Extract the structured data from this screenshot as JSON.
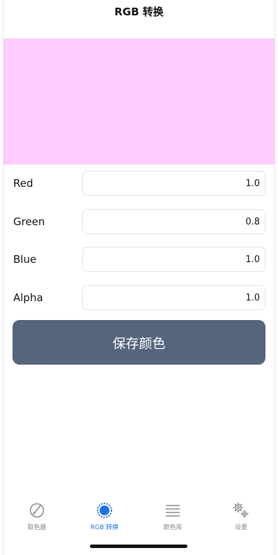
{
  "header": {
    "title": "RGB 转换"
  },
  "preview": {
    "color": "#ffccff"
  },
  "fields": [
    {
      "label": "Red",
      "value": "1.0"
    },
    {
      "label": "Green",
      "value": "0.8"
    },
    {
      "label": "Blue",
      "value": "1.0"
    },
    {
      "label": "Alpha",
      "value": "1.0"
    }
  ],
  "save_button": {
    "label": "保存颜色",
    "color": "#56647c"
  },
  "tabbar": {
    "active_color": "#1a73e8",
    "inactive_color": "#888888",
    "tabs": [
      {
        "label": "取色器",
        "icon": "eyedropper-icon",
        "active": false
      },
      {
        "label": "RGB 转换",
        "icon": "color-circle-icon",
        "active": true
      },
      {
        "label": "颜色库",
        "icon": "list-icon",
        "active": false
      },
      {
        "label": "设置",
        "icon": "gear-icon",
        "active": false
      }
    ]
  }
}
